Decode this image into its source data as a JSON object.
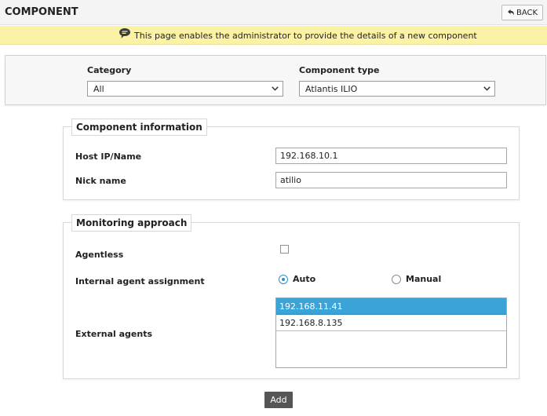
{
  "header": {
    "title": "COMPONENT",
    "back_label": "BACK"
  },
  "info": {
    "message": "This page enables the administrator to provide the details of a new component"
  },
  "filters": {
    "category_label": "Category",
    "category_value": "All",
    "component_type_label": "Component type",
    "component_type_value": "Atlantis ILIO"
  },
  "component_info": {
    "legend": "Component information",
    "host_label": "Host IP/Name",
    "host_value": "192.168.10.1",
    "nick_label": "Nick name",
    "nick_value": "atilio"
  },
  "monitoring": {
    "legend": "Monitoring approach",
    "agentless_label": "Agentless",
    "agentless_checked": false,
    "internal_label": "Internal agent assignment",
    "auto_label": "Auto",
    "manual_label": "Manual",
    "selected_mode": "Auto",
    "external_label": "External agents",
    "external_agents": [
      "192.168.11.41",
      "192.168.8.135"
    ],
    "selected_agent": "192.168.11.41"
  },
  "actions": {
    "add_label": "Add"
  },
  "colors": {
    "info_bar": "#fcf2a6",
    "selected_row": "#3aa4d8",
    "add_button": "#555555",
    "radio_accent": "#2f8fc8"
  },
  "icons": {
    "back": "back-arrow-icon",
    "info": "speech-bubble-icon",
    "dropdown": "chevron-down-icon"
  }
}
